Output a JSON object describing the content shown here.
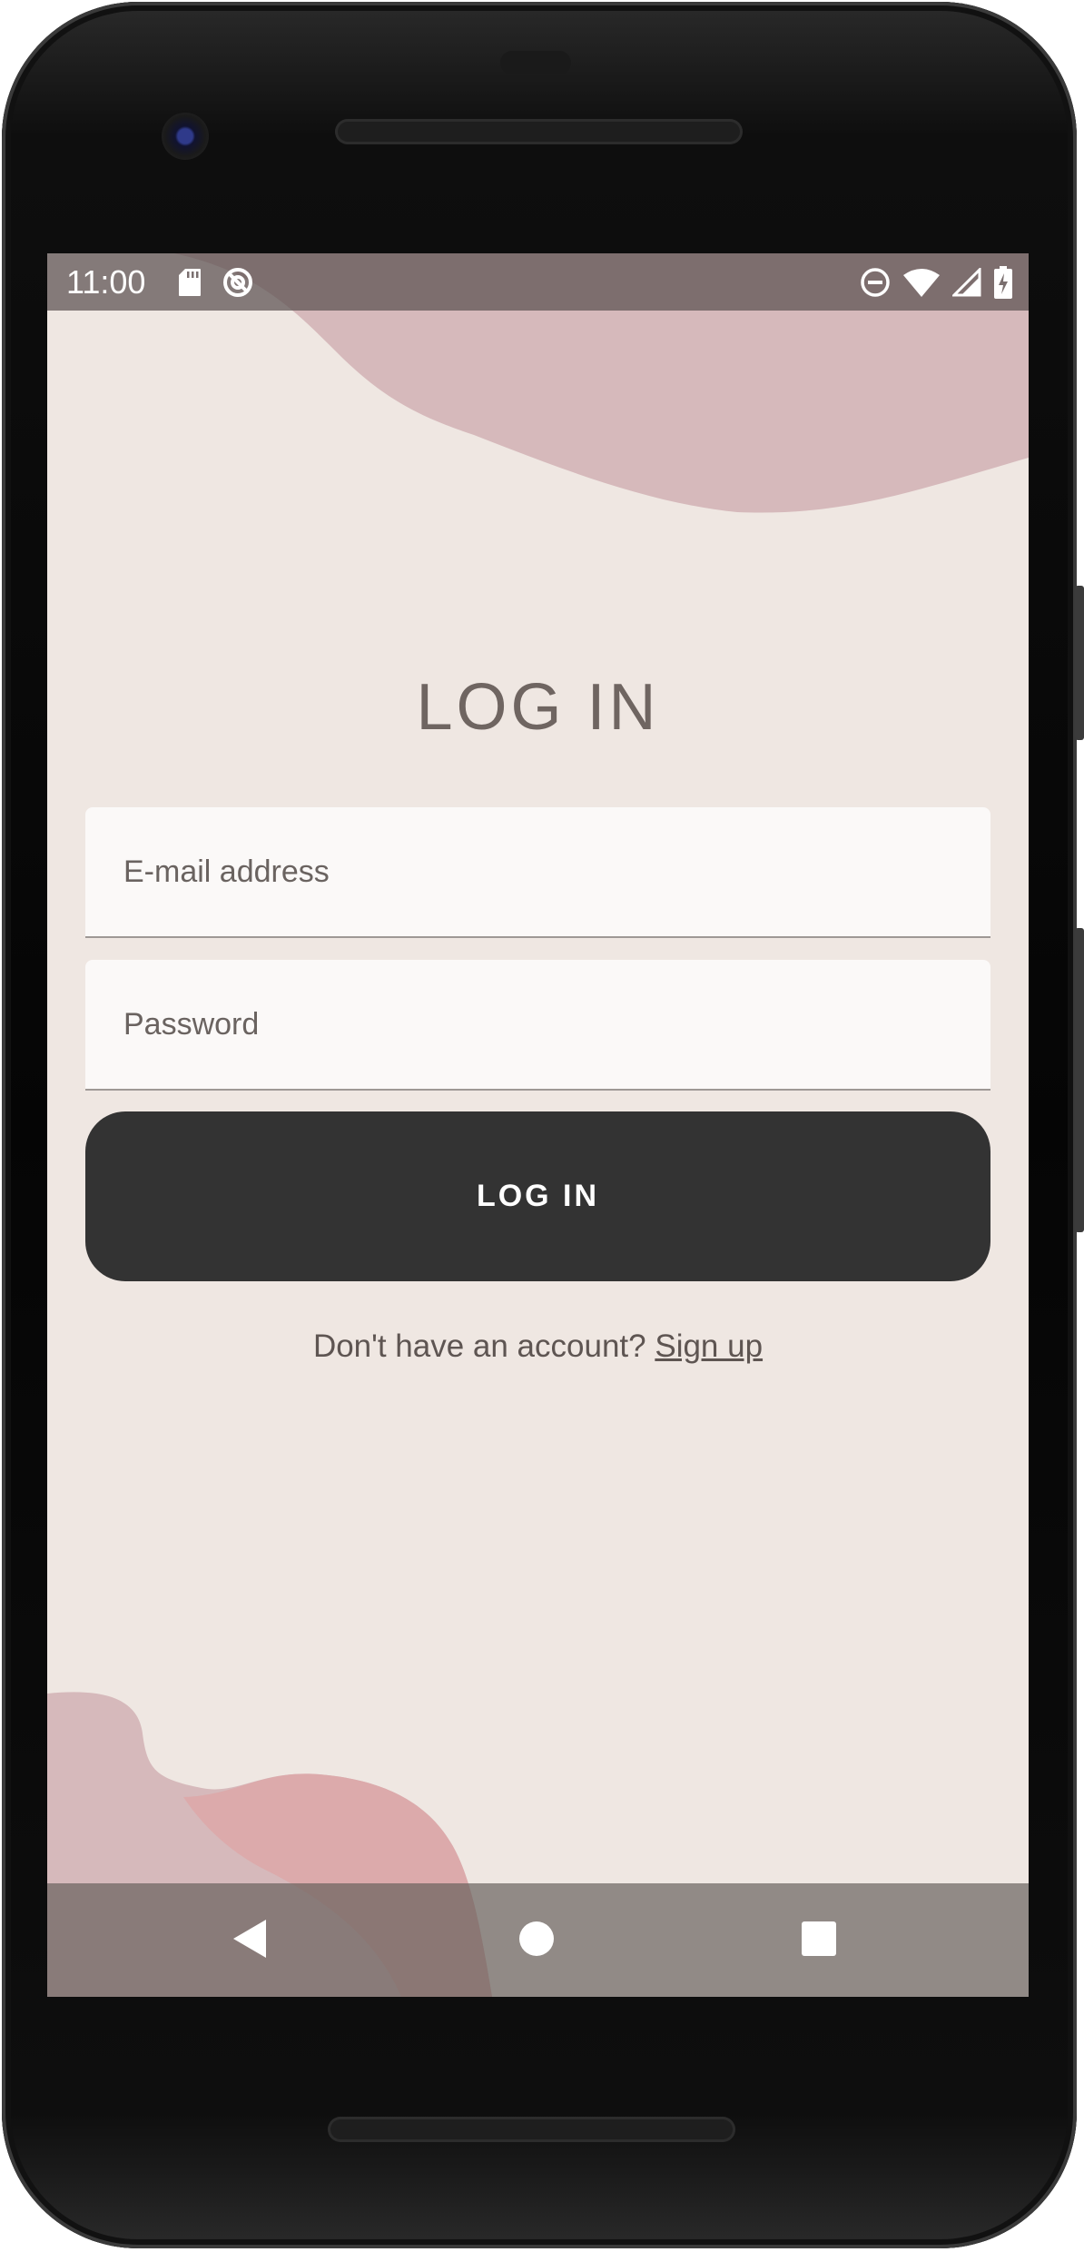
{
  "status_bar": {
    "time": "11:00",
    "left_icons": [
      "sd-card-icon",
      "data-saver-icon"
    ],
    "right_icons": [
      "do-not-disturb-icon",
      "wifi-icon",
      "cell-signal-icon",
      "battery-charging-icon"
    ]
  },
  "login": {
    "title": "LOG IN",
    "email_placeholder": "E-mail address",
    "password_placeholder": "Password",
    "button_label": "LOG IN",
    "signup_prompt": "Don't have an account?",
    "signup_link": "Sign up"
  },
  "nav_bar": {
    "buttons": [
      "back-icon",
      "home-icon",
      "recents-icon"
    ]
  },
  "colors": {
    "background": "#efe7e2",
    "blob_top": "#d6b9bb",
    "blob_bottom": "#dcaaab",
    "button": "#333333",
    "title_text": "#6f6561"
  }
}
